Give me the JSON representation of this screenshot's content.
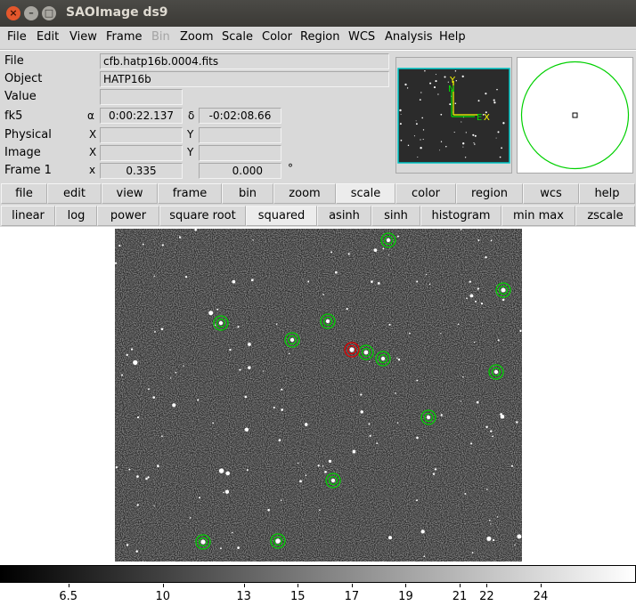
{
  "window": {
    "title": "SAOImage ds9"
  },
  "menubar": [
    {
      "label": "File",
      "disabled": false
    },
    {
      "label": "Edit",
      "disabled": false
    },
    {
      "label": "View",
      "disabled": false
    },
    {
      "label": "Frame",
      "disabled": false
    },
    {
      "label": "Bin",
      "disabled": true
    },
    {
      "label": "Zoom",
      "disabled": false
    },
    {
      "label": "Scale",
      "disabled": false
    },
    {
      "label": "Color",
      "disabled": false
    },
    {
      "label": "Region",
      "disabled": false
    },
    {
      "label": "WCS",
      "disabled": false
    },
    {
      "label": "Analysis",
      "disabled": false
    },
    {
      "label": "Help",
      "disabled": false
    }
  ],
  "info": {
    "file_label": "File",
    "file_value": "cfb.hatp16b.0004.fits",
    "object_label": "Object",
    "object_value": "HATP16b",
    "value_label": "Value",
    "value_value": "",
    "fk5_label": "fk5",
    "alpha_symbol": "α",
    "alpha_value": "0:00:22.137",
    "delta_symbol": "δ",
    "delta_value": "-0:02:08.66",
    "physical_label": "Physical",
    "physical_x_label": "X",
    "physical_x": "",
    "physical_y_label": "Y",
    "physical_y": "",
    "image_label": "Image",
    "image_x_label": "X",
    "image_x": "",
    "image_y_label": "Y",
    "image_y": "",
    "frame_label": "Frame 1",
    "frame_x_label": "x",
    "frame_zoom": "0.335",
    "frame_angle": "0.000",
    "degree_symbol": "°"
  },
  "panner": {
    "compass_y": "Y",
    "compass_n": "N",
    "compass_e": "E",
    "compass_x": "X"
  },
  "button_bar": [
    {
      "label": "file",
      "active": false
    },
    {
      "label": "edit",
      "active": false
    },
    {
      "label": "view",
      "active": false
    },
    {
      "label": "frame",
      "active": false
    },
    {
      "label": "bin",
      "active": false
    },
    {
      "label": "zoom",
      "active": false
    },
    {
      "label": "scale",
      "active": true
    },
    {
      "label": "color",
      "active": false
    },
    {
      "label": "region",
      "active": false
    },
    {
      "label": "wcs",
      "active": false
    },
    {
      "label": "help",
      "active": false
    }
  ],
  "scale_bar": [
    {
      "label": "linear",
      "active": false
    },
    {
      "label": "log",
      "active": false
    },
    {
      "label": "power",
      "active": false
    },
    {
      "label": "square root",
      "active": false
    },
    {
      "label": "squared",
      "active": true
    },
    {
      "label": "asinh",
      "active": false
    },
    {
      "label": "sinh",
      "active": false
    },
    {
      "label": "histogram",
      "active": false
    },
    {
      "label": "min max",
      "active": false
    },
    {
      "label": "zscale",
      "active": false
    }
  ],
  "colorbar": {
    "ticks": [
      "6.5",
      "10",
      "13",
      "15",
      "17",
      "19",
      "21",
      "22",
      "24"
    ],
    "range": [
      4.0,
      27.5
    ]
  },
  "colors": {
    "region_green": "#00d000",
    "region_red": "#e00000",
    "compass": "#ffff00",
    "panner_frame": "#00c8c8"
  }
}
